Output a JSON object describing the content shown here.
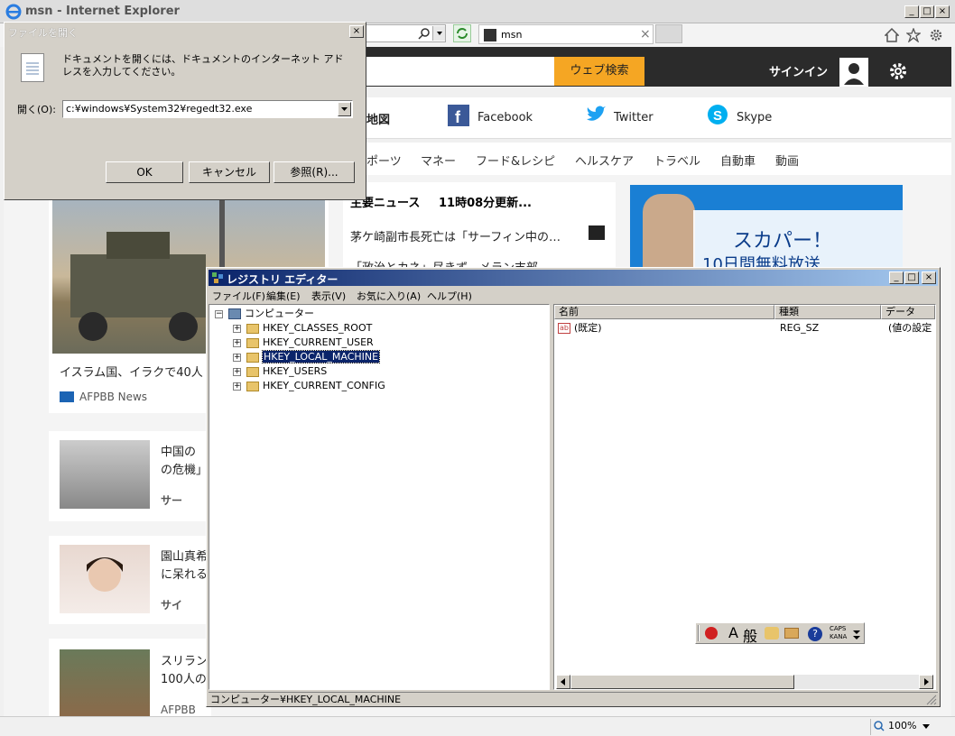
{
  "ie": {
    "title": "msn - Internet Explorer",
    "tab_title": "msn",
    "zoom": "100%",
    "window_buttons": [
      "_",
      "□",
      "×"
    ]
  },
  "msn": {
    "search_button": "ウェブ検索",
    "signin": "サインイン",
    "links": [
      "地図",
      "Facebook",
      "Twitter",
      "Skype"
    ],
    "nav": [
      "ポーツ",
      "マネー",
      "フード&レシピ",
      "ヘルスケア",
      "トラベル",
      "自動車",
      "動画"
    ],
    "top_news_heading": "主要ニュース",
    "top_news_time": "11時08分更新...",
    "news_line1": "茅ケ崎副市長死亡は「サーフィン中の…",
    "news_line2": "「政治とカネ」尽きず　メラン支部",
    "main_caption": "イスラム国、イラクで40人",
    "main_source": "AFPBB News",
    "ad_line1": "スカパー！",
    "ad_line2": "10日間無料放送",
    "side_items": [
      {
        "line1": "中国の",
        "line2": "の危機」",
        "source": "サー"
      },
      {
        "line1": "園山真希",
        "line2": "に呆れる",
        "source": "サイ"
      },
      {
        "line1": "スリラン",
        "line2": "100人の",
        "source": "AFPBB News"
      }
    ]
  },
  "open_dialog": {
    "title": "ファイルを開く",
    "message": "ドキュメントを開くには、ドキュメントのインターネット アドレスを入力してください。",
    "open_label": "開く(O):",
    "combo_value": "c:¥windows¥System32¥regedt32.exe",
    "ok": "OK",
    "cancel": "キャンセル",
    "browse": "参照(R)..."
  },
  "regedit": {
    "title": "レジストリ エディター",
    "menu": [
      "ファイル(F)",
      "編集(E)",
      "表示(V)",
      "お気に入り(A)",
      "ヘルプ(H)"
    ],
    "tree_root": "コンピューター",
    "tree_items": [
      "HKEY_CLASSES_ROOT",
      "HKEY_CURRENT_USER",
      "HKEY_LOCAL_MACHINE",
      "HKEY_USERS",
      "HKEY_CURRENT_CONFIG"
    ],
    "selected_index": 2,
    "columns": [
      "名前",
      "種類",
      "データ"
    ],
    "rows": [
      {
        "name": "(既定)",
        "type": "REG_SZ",
        "data": "(値の設定"
      }
    ],
    "status": "コンピューター¥HKEY_LOCAL_MACHINE"
  },
  "ime": {
    "mode": "A",
    "dict": "般",
    "caps": "CAPS",
    "kana": "KANA"
  },
  "colors": {
    "accent": "#f5a623",
    "reg_title": "#0a246a",
    "selection": "#0a246a"
  }
}
